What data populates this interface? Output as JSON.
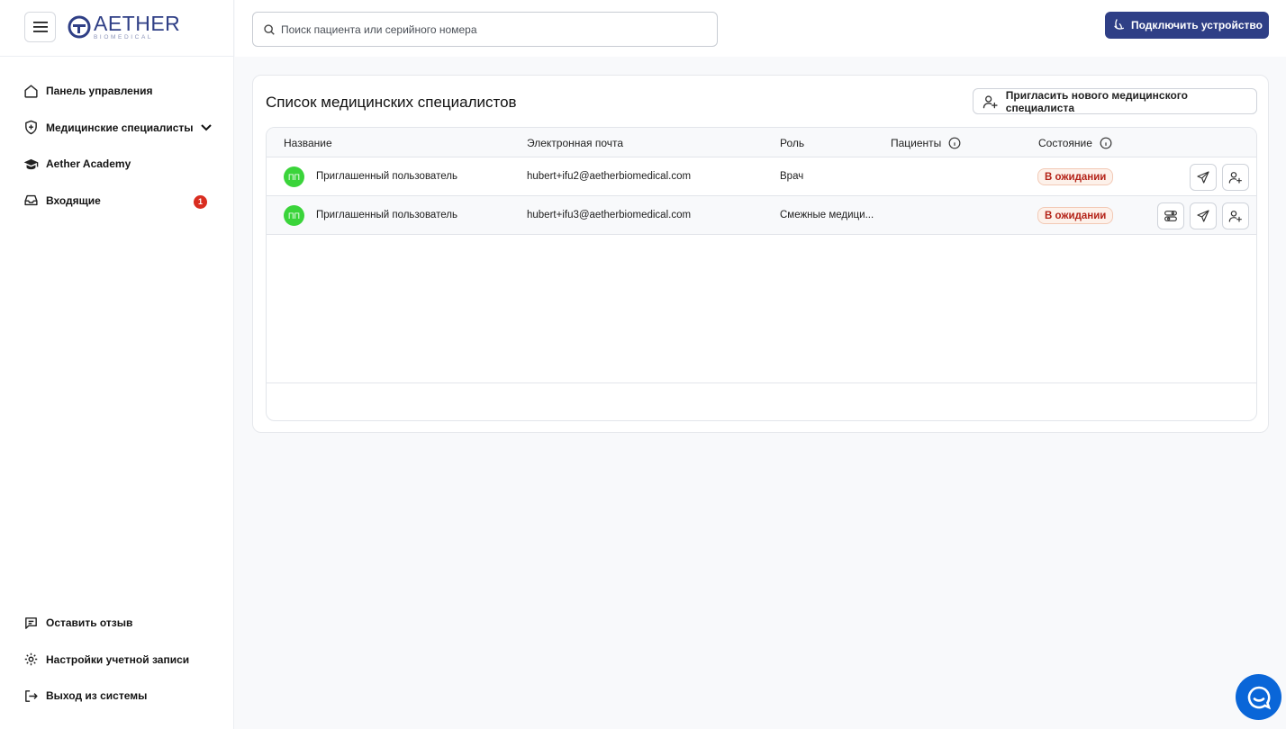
{
  "brand": {
    "name": "AETHER",
    "sub": "BIOMEDICAL",
    "color": "#2f3f86"
  },
  "sidebar": {
    "items": [
      {
        "label": "Панель управления",
        "icon": "home-icon"
      },
      {
        "label": "Медицинские специалисты",
        "icon": "shield-plus-icon",
        "expandable": true
      },
      {
        "label": "Aether Academy",
        "icon": "graduation-cap-icon"
      },
      {
        "label": "Входящие",
        "icon": "inbox-icon",
        "badge": "1"
      }
    ],
    "bottom_items": [
      {
        "label": "Оставить отзыв",
        "icon": "feedback-icon"
      },
      {
        "label": "Настройки учетной записи",
        "icon": "gear-icon"
      },
      {
        "label": "Выход из системы",
        "icon": "logout-icon"
      }
    ]
  },
  "header": {
    "search_placeholder": "Поиск пациента или серийного номера",
    "connect_label": "Подключить устройство"
  },
  "main": {
    "title": "Список медицинских специалистов",
    "invite_label": "Пригласить нового медицинского специалиста",
    "columns": {
      "name": "Название",
      "email": "Электронная почта",
      "role": "Роль",
      "patients": "Пациенты",
      "status": "Состояние"
    },
    "rows": [
      {
        "initials": "ПП",
        "name": "Приглашенный пользователь",
        "email": "hubert+ifu2@aetherbiomedical.com",
        "role": "Врач",
        "patients": "",
        "status": "В ожидании"
      },
      {
        "initials": "ПП",
        "name": "Приглашенный пользователь",
        "email": "hubert+ifu3@aetherbiomedical.com",
        "role": "Смежные медици...",
        "patients": "",
        "status": "В ожидании"
      }
    ]
  },
  "colors": {
    "accent": "#2f3f86",
    "avatar": "#3ad43a",
    "status_text": "#b42318",
    "badge": "#d92d20",
    "chat": "#0a66d8"
  }
}
